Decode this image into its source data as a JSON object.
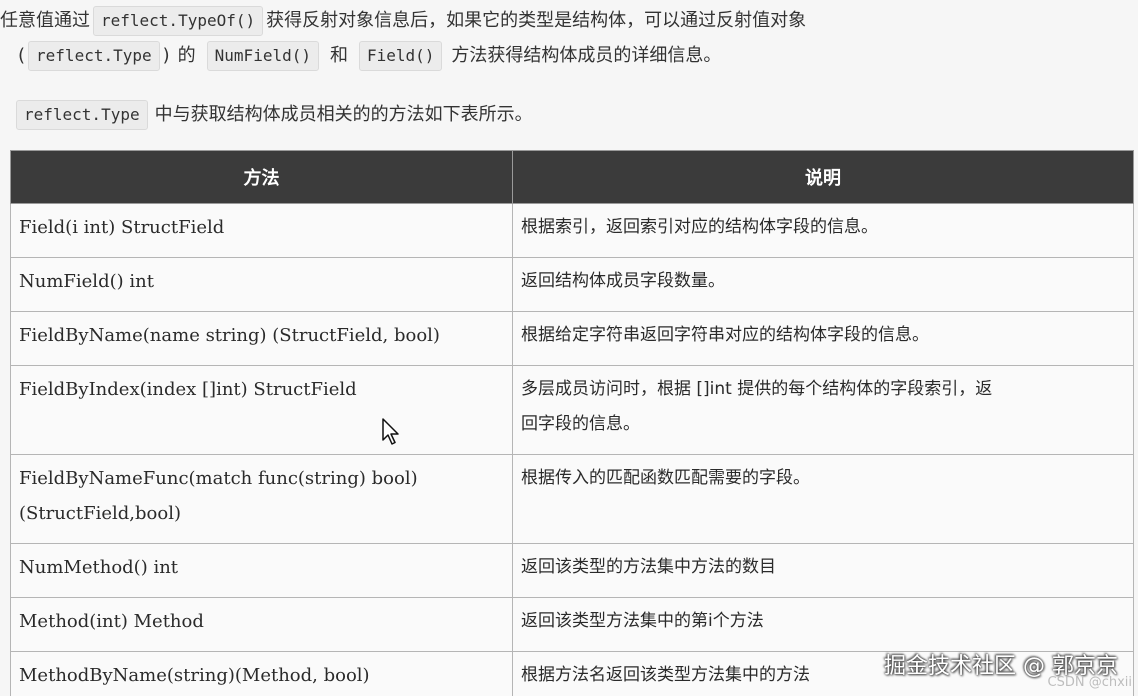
{
  "intro": {
    "line1": {
      "t1": "任意值通过",
      "c1": "reflect.TypeOf()",
      "t2": "获得反射对象信息后，如果它的类型是结构体，可以通过反射值对象"
    },
    "line2": {
      "open": "(",
      "c1": "reflect.Type",
      "t1": ")",
      "t2": "的",
      "c2": "NumField()",
      "t3": "和",
      "c3": "Field()",
      "t4": "方法获得结构体成员的详细信息。"
    },
    "line3": {
      "c1": "reflect.Type",
      "t1": "中与获取结构体成员相关的的方法如下表所示。"
    }
  },
  "table": {
    "headers": [
      "方法",
      "说明"
    ],
    "rows": [
      {
        "method": [
          "Field(i int) StructField"
        ],
        "desc": [
          "根据索引，返回索引对应的结构体字段的信息。"
        ]
      },
      {
        "method": [
          "NumField() int"
        ],
        "desc": [
          "返回结构体成员字段数量。"
        ]
      },
      {
        "method": [
          "FieldByName(name string) (StructField, bool)"
        ],
        "desc": [
          "根据给定字符串返回字符串对应的结构体字段的信息。"
        ]
      },
      {
        "method": [
          "FieldByIndex(index []int) StructField"
        ],
        "desc": [
          "多层成员访问时，根据 []int 提供的每个结构体的字段索引，返",
          "回字段的信息。"
        ]
      },
      {
        "method": [
          "FieldByNameFunc(match func(string) bool)",
          "(StructField,bool)"
        ],
        "desc": [
          "根据传入的匹配函数匹配需要的字段。"
        ]
      },
      {
        "method": [
          "NumMethod() int"
        ],
        "desc": [
          "返回该类型的方法集中方法的数目"
        ]
      },
      {
        "method": [
          "Method(int) Method"
        ],
        "desc": [
          "返回该类型方法集中的第i个方法"
        ]
      },
      {
        "method": [
          "MethodByName(string)(Method, bool)"
        ],
        "desc": [
          "根据方法名返回该类型方法集中的方法"
        ]
      }
    ]
  },
  "overlay": {
    "watermark": "掘金技术社区 @ 郭京京",
    "csdn": "CSDN @chxii"
  },
  "icons": {
    "cursor": "mouse-pointer-icon"
  }
}
